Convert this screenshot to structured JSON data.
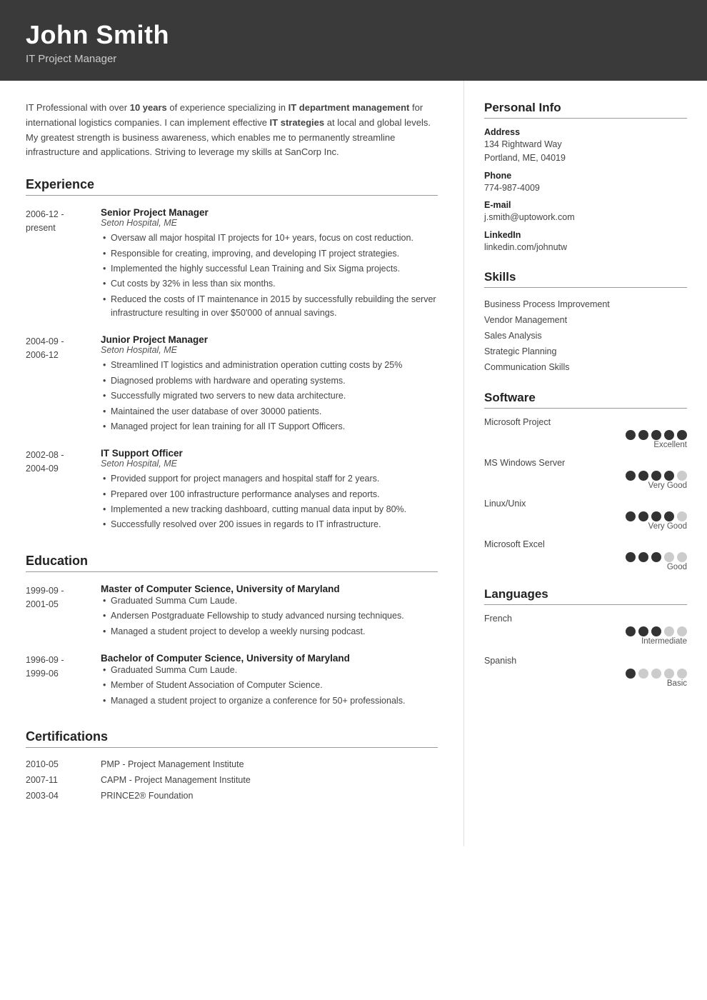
{
  "header": {
    "name": "John Smith",
    "title": "IT Project Manager"
  },
  "summary": {
    "text_parts": [
      "IT Professional with over ",
      "10 years",
      " of experience specializing in ",
      "IT department management",
      " for international logistics companies. I can implement effective ",
      "IT strategies",
      " at local and global levels. My greatest strength is business awareness, which enables me to permanently streamline infrastructure and applications. Striving to leverage my skills at SanCorp Inc."
    ]
  },
  "experience": {
    "section_label": "Experience",
    "entries": [
      {
        "date_start": "2006-12 -",
        "date_end": "present",
        "title": "Senior Project Manager",
        "company": "Seton Hospital, ME",
        "bullets": [
          "Oversaw all major hospital IT projects for 10+ years, focus on cost reduction.",
          "Responsible for creating, improving, and developing IT project strategies.",
          "Implemented the highly successful Lean Training and Six Sigma projects.",
          "Cut costs by 32% in less than six months.",
          "Reduced the costs of IT maintenance in 2015 by successfully rebuilding the server infrastructure resulting in over $50'000 of annual savings."
        ]
      },
      {
        "date_start": "2004-09 -",
        "date_end": "2006-12",
        "title": "Junior Project Manager",
        "company": "Seton Hospital, ME",
        "bullets": [
          "Streamlined IT logistics and administration operation cutting costs by 25%",
          "Diagnosed problems with hardware and operating systems.",
          "Successfully migrated two servers to new data architecture.",
          "Maintained the user database of over 30000 patients.",
          "Managed project for lean training for all IT Support Officers."
        ]
      },
      {
        "date_start": "2002-08 -",
        "date_end": "2004-09",
        "title": "IT Support Officer",
        "company": "Seton Hospital, ME",
        "bullets": [
          "Provided support for project managers and hospital staff for 2 years.",
          "Prepared over 100 infrastructure performance analyses and reports.",
          "Implemented a new tracking dashboard, cutting manual data input by 80%.",
          "Successfully resolved over 200 issues in regards to IT infrastructure."
        ]
      }
    ]
  },
  "education": {
    "section_label": "Education",
    "entries": [
      {
        "date_start": "1999-09 -",
        "date_end": "2001-05",
        "title": "Master of Computer Science, University of Maryland",
        "bullets": [
          "Graduated Summa Cum Laude.",
          "Andersen Postgraduate Fellowship to study advanced nursing techniques.",
          "Managed a student project to develop a weekly nursing podcast."
        ]
      },
      {
        "date_start": "1996-09 -",
        "date_end": "1999-06",
        "title": "Bachelor of Computer Science, University of Maryland",
        "bullets": [
          "Graduated Summa Cum Laude.",
          "Member of Student Association of Computer Science.",
          "Managed a student project to organize a conference for 50+ professionals."
        ]
      }
    ]
  },
  "certifications": {
    "section_label": "Certifications",
    "entries": [
      {
        "date": "2010-05",
        "text": "PMP - Project Management Institute"
      },
      {
        "date": "2007-11",
        "text": "CAPM - Project Management Institute"
      },
      {
        "date": "2003-04",
        "text": "PRINCE2® Foundation"
      }
    ]
  },
  "personal_info": {
    "section_label": "Personal Info",
    "fields": [
      {
        "label": "Address",
        "value": "134 Rightward Way\nPortland, ME, 04019"
      },
      {
        "label": "Phone",
        "value": "774-987-4009"
      },
      {
        "label": "E-mail",
        "value": "j.smith@uptowork.com"
      },
      {
        "label": "LinkedIn",
        "value": "linkedin.com/johnutw"
      }
    ]
  },
  "skills": {
    "section_label": "Skills",
    "items": [
      "Business Process Improvement",
      "Vendor Management",
      "Sales Analysis",
      "Strategic Planning",
      "Communication Skills"
    ]
  },
  "software": {
    "section_label": "Software",
    "items": [
      {
        "name": "Microsoft Project",
        "filled": 5,
        "total": 5,
        "label": "Excellent"
      },
      {
        "name": "MS Windows Server",
        "filled": 4,
        "total": 5,
        "label": "Very Good"
      },
      {
        "name": "Linux/Unix",
        "filled": 4,
        "total": 5,
        "label": "Very Good"
      },
      {
        "name": "Microsoft Excel",
        "filled": 3,
        "total": 5,
        "label": "Good"
      }
    ]
  },
  "languages": {
    "section_label": "Languages",
    "items": [
      {
        "name": "French",
        "filled": 3,
        "total": 5,
        "label": "Intermediate"
      },
      {
        "name": "Spanish",
        "filled": 1,
        "total": 5,
        "label": "Basic"
      }
    ]
  }
}
